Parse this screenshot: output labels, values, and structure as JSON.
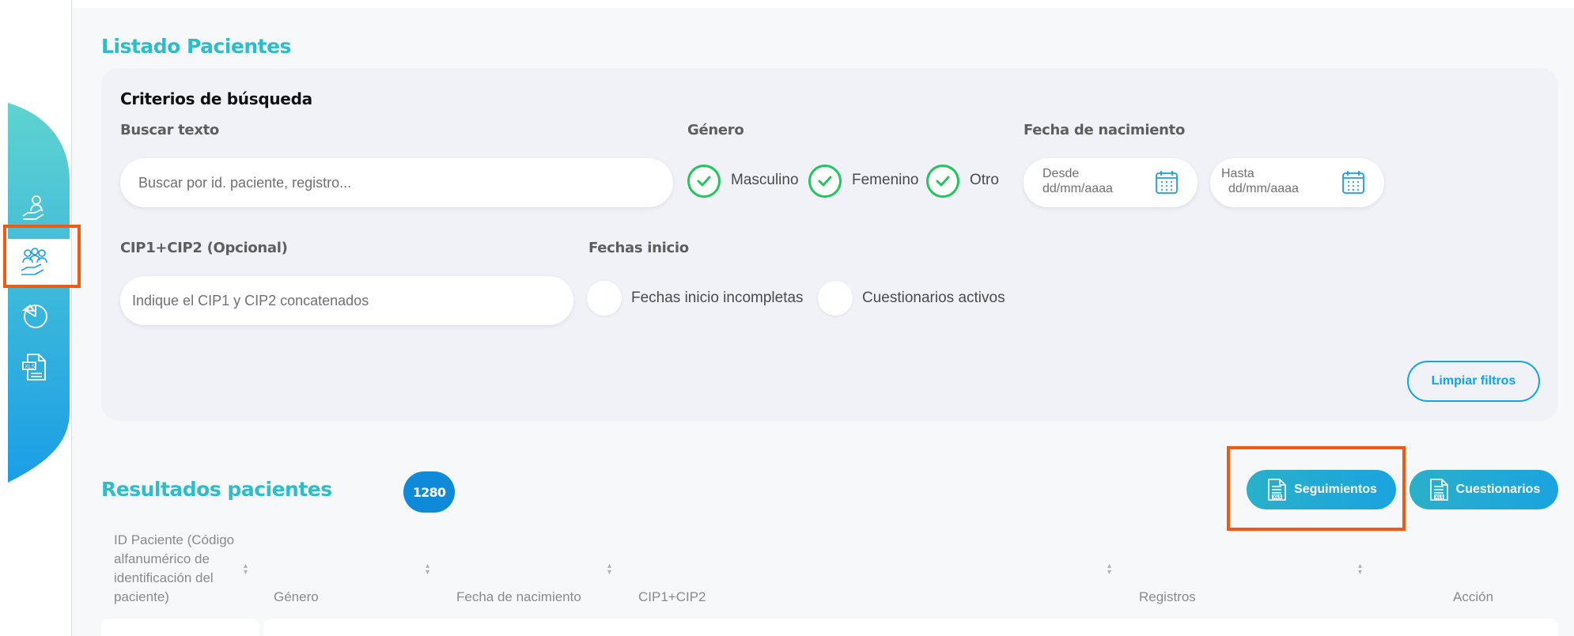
{
  "page": {
    "title": "Listado Pacientes"
  },
  "filters": {
    "heading": "Criterios de búsqueda",
    "search_label": "Buscar texto",
    "search_placeholder": "Buscar por id. paciente, registro...",
    "gender_label": "Género",
    "gender_options": [
      {
        "label": "Masculino",
        "checked": true
      },
      {
        "label": "Femenino",
        "checked": true
      },
      {
        "label": "Otro",
        "checked": true
      }
    ],
    "birthdate_label": "Fecha de nacimiento",
    "date_from_label": "Desde",
    "date_from_value": "dd/mm/aaaa",
    "date_to_label": "Hasta",
    "date_to_value": "dd/mm/aaaa",
    "cip_label": "CIP1+CIP2 (Opcional)",
    "cip_placeholder": "Indique el CIP1 y CIP2 concatenados",
    "start_dates_label": "Fechas inicio",
    "start_dates_options": [
      {
        "label": "Fechas inicio incompletas",
        "checked": false
      },
      {
        "label": "Cuestionarios activos",
        "checked": false
      }
    ],
    "clear_button": "Limpiar filtros"
  },
  "results": {
    "title": "Resultados pacientes",
    "count": "1280",
    "export_seguimientos": "Seguimientos",
    "export_cuestionarios": "Cuestionarios",
    "columns": [
      "ID Paciente (Código alfanumérico de identificación del paciente)",
      "Género",
      "Fecha de nacimiento",
      "CIP1+CIP2",
      "Registros",
      "Acción"
    ]
  },
  "sidebar": {
    "items": [
      {
        "icon": "patient-care-icon",
        "active": false
      },
      {
        "icon": "patients-group-icon",
        "active": true
      },
      {
        "icon": "pie-chart-icon",
        "active": false
      },
      {
        "icon": "xls-report-icon",
        "active": false
      }
    ]
  },
  "colors": {
    "accent_teal": "#2dbcc8",
    "accent_blue": "#0ea5e9",
    "check_green": "#22c55e",
    "highlight_orange": "#f25a12"
  }
}
